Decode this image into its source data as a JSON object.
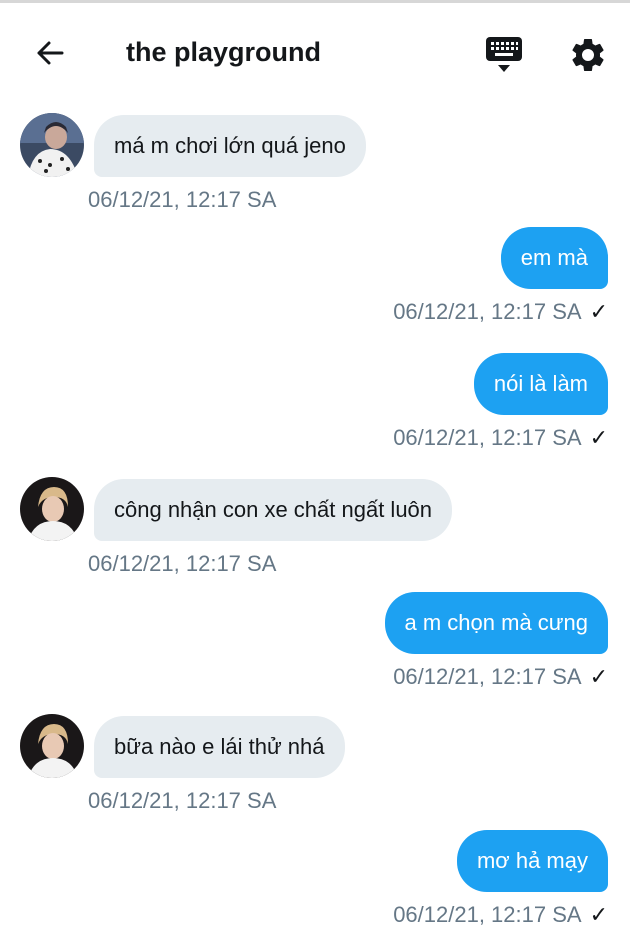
{
  "header": {
    "title": "the playground",
    "back_icon": "arrow-left-icon",
    "keyboard_icon": "keyboard-icon",
    "settings_icon": "gear-icon"
  },
  "colors": {
    "outgoing_bubble": "#1da1f2",
    "incoming_bubble": "#e6ecf0",
    "timestamp": "#657786"
  },
  "messages": [
    {
      "direction": "in",
      "text": "má m chơi lớn quá jeno",
      "time": "06/12/21, 12:17 SA"
    },
    {
      "direction": "out",
      "text": "em mà",
      "time": "06/12/21, 12:17 SA",
      "status": "✓"
    },
    {
      "direction": "out",
      "text": "nói là làm",
      "time": "06/12/21, 12:17 SA",
      "status": "✓"
    },
    {
      "direction": "in",
      "text": "công nhận con xe chất ngất luôn",
      "time": "06/12/21, 12:17 SA"
    },
    {
      "direction": "out",
      "text": "a m chọn mà cưng",
      "time": "06/12/21, 12:17 SA",
      "status": "✓"
    },
    {
      "direction": "in",
      "text": "bữa nào e lái thử nhá",
      "time": "06/12/21, 12:17 SA"
    },
    {
      "direction": "out",
      "text": "mơ hả mạy",
      "time": "06/12/21, 12:17 SA",
      "status": "✓"
    }
  ]
}
